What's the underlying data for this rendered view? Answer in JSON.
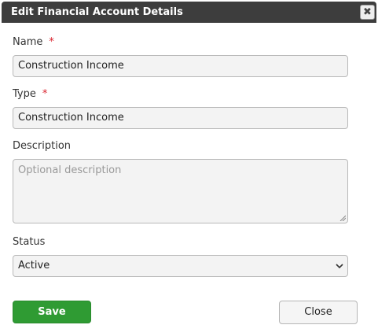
{
  "dialog": {
    "title": "Edit Financial Account Details",
    "close_icon_glyph": "✖"
  },
  "form": {
    "name": {
      "label": "Name",
      "required_mark": "*",
      "value": "Construction Income"
    },
    "type": {
      "label": "Type",
      "required_mark": "*",
      "value": "Construction Income"
    },
    "description": {
      "label": "Description",
      "value": "",
      "placeholder": "Optional description"
    },
    "status": {
      "label": "Status",
      "selected": "Active"
    }
  },
  "buttons": {
    "save_label": "Save",
    "close_label": "Close"
  },
  "colors": {
    "titlebar": "#3d3d3d",
    "save_button": "#2f9b33",
    "required": "#d9232e"
  }
}
